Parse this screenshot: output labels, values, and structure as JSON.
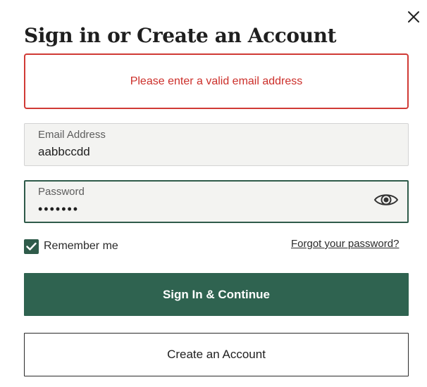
{
  "dialog": {
    "title": "Sign in or Create an Account",
    "close_icon": "close-icon"
  },
  "error": {
    "message": "Please enter a valid email address",
    "color": "#cc2f2a"
  },
  "email": {
    "label": "Email Address",
    "value": "aabbccdd"
  },
  "password": {
    "label": "Password",
    "value": "•••••••",
    "toggle_icon": "eye-icon"
  },
  "remember": {
    "label": "Remember me",
    "checked": true
  },
  "links": {
    "forgot_password": "Forgot your password?"
  },
  "actions": {
    "sign_in": "Sign In & Continue",
    "create_account": "Create an Account"
  },
  "colors": {
    "brand_green": "#2f6350",
    "error_red": "#d03a35"
  }
}
